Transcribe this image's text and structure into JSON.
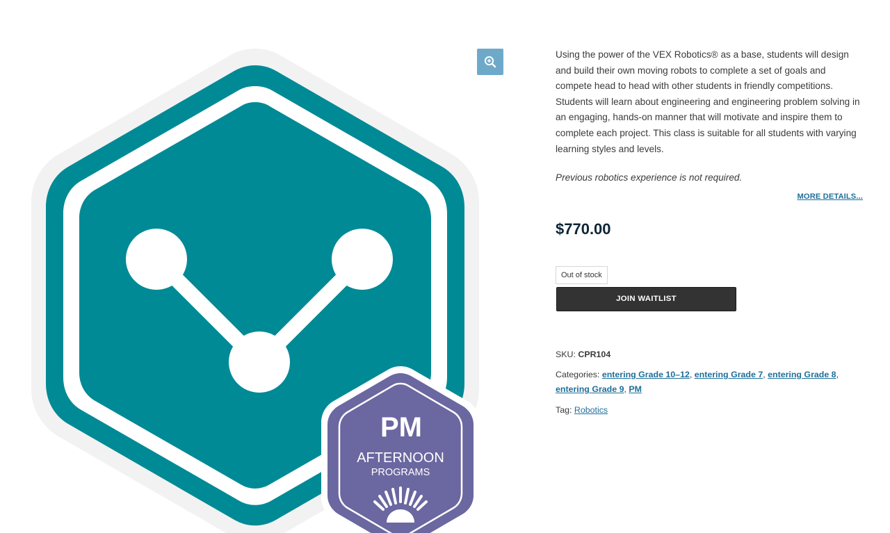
{
  "gallery": {
    "zoom_icon": "zoom-in-icon",
    "badge": {
      "top": "PM",
      "line1": "AFTERNOON",
      "line2": "PROGRAMS"
    },
    "colors": {
      "teal": "#008a95",
      "purple": "#6b67a0"
    }
  },
  "summary": {
    "description": "Using the power of the VEX Robotics® as a base, students will design and build their own moving robots to complete a set of goals and compete head to head with other students in friendly competitions. Students will learn about engineering and engineering problem solving in an engaging, hands-on manner that will motivate and inspire them to complete each project. This class is suitable for all students with varying learning styles and levels.",
    "note": "Previous robotics experience is not required.",
    "more_details": "MORE DETAILS...",
    "price": "$770.00",
    "stock_status": "Out of stock",
    "waitlist_label": "JOIN WAITLIST"
  },
  "meta": {
    "sku_label": "SKU:",
    "sku": "CPR104",
    "categories_label": "Categories:",
    "categories": [
      "entering Grade 10–12",
      "entering Grade 7",
      "entering Grade 8",
      "entering Grade 9",
      "PM"
    ],
    "tag_label": "Tag:",
    "tag": "Robotics"
  }
}
